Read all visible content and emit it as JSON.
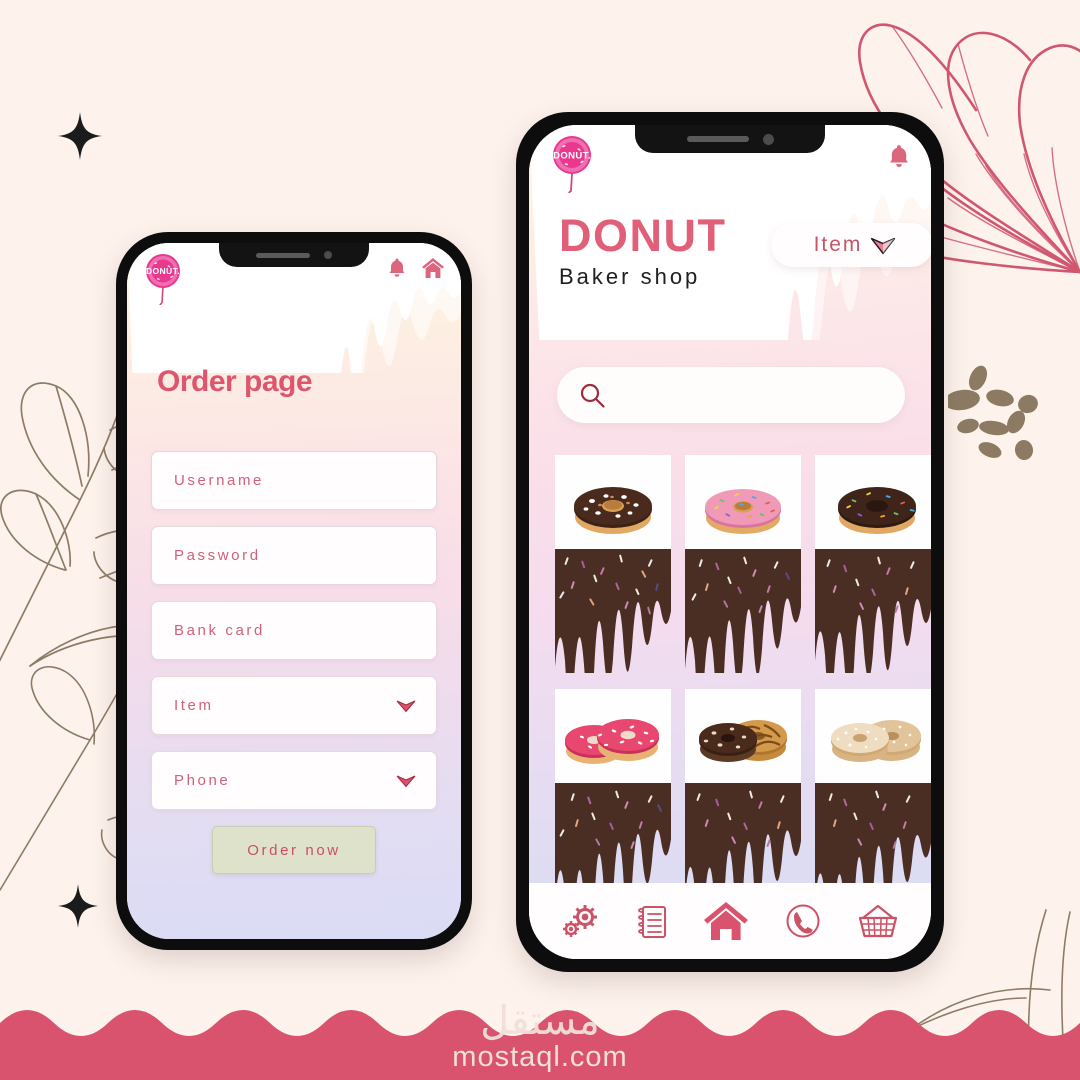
{
  "canvas": {
    "background_color": "#fdf3ec",
    "accent_pink": "#dd566d",
    "accent_rose": "#e0607a",
    "wave_color": "#d9536f",
    "chocolate": "#4b2e23",
    "button_green": "#dfe2cb"
  },
  "watermark": {
    "arabic": "مستقل",
    "url": "mostaql.com"
  },
  "left_phone": {
    "name": "order-page-screen",
    "logo_text": "DONUT",
    "top_icons": [
      "bell-icon",
      "home-icon"
    ],
    "title": "Order page",
    "fields": [
      {
        "label": "Username",
        "type": "text",
        "value": "",
        "has_caret": false
      },
      {
        "label": "Password",
        "type": "password",
        "value": "",
        "has_caret": false
      },
      {
        "label": "Bank card",
        "type": "text",
        "value": "",
        "has_caret": false
      },
      {
        "label": "Item",
        "type": "select",
        "value": "",
        "has_caret": true
      },
      {
        "label": "Phone",
        "type": "select",
        "value": "",
        "has_caret": true
      }
    ],
    "submit_label": "Order now"
  },
  "right_phone": {
    "name": "baker-shop-home-screen",
    "logo_text": "DONUT",
    "bell_icon": "bell-icon",
    "brand_title": "DONUT",
    "brand_subtitle": "Baker shop",
    "item_dropdown": {
      "label": "Item",
      "icon": "chevron-down-icon"
    },
    "search": {
      "placeholder": "",
      "value": "",
      "icon": "search-icon"
    },
    "products": [
      {
        "row": 1,
        "col": 1,
        "name": "chocolate-glazed-donut",
        "glaze": "#3b2118",
        "sprinkles": "white"
      },
      {
        "row": 1,
        "col": 2,
        "name": "pink-sprinkle-donut",
        "glaze": "#f19ab8",
        "sprinkles": "multi"
      },
      {
        "row": 1,
        "col": 3,
        "name": "chocolate-rainbow-donut",
        "glaze": "#3b2118",
        "sprinkles": "multi"
      },
      {
        "row": 2,
        "col": 1,
        "name": "pink-donut-pair",
        "glaze": "#e8486f",
        "sprinkles": "white"
      },
      {
        "row": 2,
        "col": 2,
        "name": "chocolate-caramel-pair",
        "glaze": "#4a2a1c",
        "sprinkles": "none"
      },
      {
        "row": 2,
        "col": 3,
        "name": "sugar-dusted-pair",
        "glaze": "#e7d7bf",
        "sprinkles": "none"
      }
    ],
    "nav_items": [
      {
        "label": "Settings",
        "icon": "gears-icon"
      },
      {
        "label": "Orders",
        "icon": "notepad-icon"
      },
      {
        "label": "Home",
        "icon": "home-icon"
      },
      {
        "label": "Contact",
        "icon": "phone-circle-icon"
      },
      {
        "label": "Cart",
        "icon": "basket-icon"
      }
    ]
  }
}
